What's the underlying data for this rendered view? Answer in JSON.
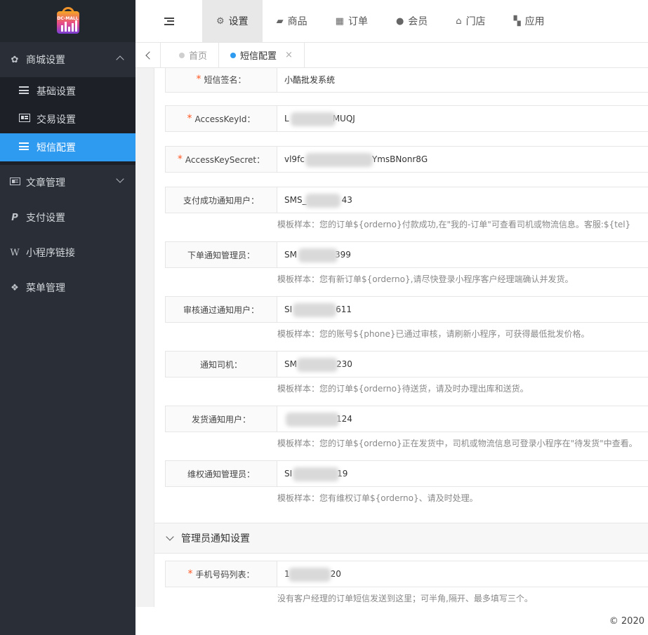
{
  "logo": {
    "text": "DC-MALL"
  },
  "sidebar": {
    "items": [
      {
        "label": "商城设置",
        "icon": "gear-icon",
        "expanded": true
      },
      {
        "label": "文章管理",
        "icon": "newspaper-icon",
        "expanded": false
      },
      {
        "label": "支付设置",
        "icon": "paypal-icon"
      },
      {
        "label": "小程序链接",
        "icon": "weixin-icon"
      },
      {
        "label": "菜单管理",
        "icon": "cubes-icon"
      }
    ],
    "sub_items": [
      {
        "label": "基础设置",
        "icon": "list-icon"
      },
      {
        "label": "交易设置",
        "icon": "id-card-icon"
      },
      {
        "label": "短信配置",
        "icon": "list-icon",
        "active": true
      }
    ]
  },
  "topnav": {
    "tabs": [
      {
        "label": "设置",
        "icon": "gears-icon",
        "active": true
      },
      {
        "label": "商品",
        "icon": "shopping-bag-icon"
      },
      {
        "label": "订单",
        "icon": "table-icon"
      },
      {
        "label": "会员",
        "icon": "user-icon"
      },
      {
        "label": "门店",
        "icon": "bank-icon"
      },
      {
        "label": "应用",
        "icon": "th-large-icon"
      }
    ]
  },
  "page_tabs": [
    {
      "label": "首页"
    },
    {
      "label": "短信配置",
      "active": true,
      "close": "×"
    }
  ],
  "form": {
    "fields": [
      {
        "label": "短信签名：",
        "required": true,
        "value": "小酷批发系统"
      },
      {
        "label": "AccessKeyId：",
        "required": true,
        "value_start": "L",
        "value_end": "MUQJ"
      },
      {
        "label": "AccessKeySecret：",
        "required": true,
        "value_start": "vl9fc",
        "value_end": "YmsBNonr8G"
      },
      {
        "label": "支付成功通知用户：",
        "value_start": "SMS_",
        "value_end": "43",
        "hint": "模板样本：您的订单${orderno}付款成功,在\"我的-订单\"可查看司机或物流信息。客服:${tel}"
      },
      {
        "label": "下单通知管理员：",
        "value_start": "SM",
        "value_end": "399",
        "hint": "模板样本：您有新订单${orderno},请尽快登录小程序客户经理端确认并发货。"
      },
      {
        "label": "审核通过通知用户：",
        "value_start": "SI",
        "value_end": "611",
        "hint": "模板样本：您的账号${phone}已通过审核，请刷新小程序，可获得最低批发价格。"
      },
      {
        "label": "通知司机：",
        "value_start": "SM",
        "value_end": "230",
        "hint": "模板样本：您的订单${orderno}待送货，请及时办理出库和送货。"
      },
      {
        "label": "发货通知用户：",
        "value_start": "",
        "value_end": "124",
        "hint": "模板样本：您的订单${orderno}正在发货中，司机或物流信息可登录小程序在\"待发货\"中查看。"
      },
      {
        "label": "维权通知管理员：",
        "value_start": "SI",
        "value_end": "19",
        "hint": "模板样本：您有维权订单${orderno}、请及时处理。"
      }
    ],
    "section_title": "管理员通知设置",
    "admin_field": {
      "label": "手机号码列表：",
      "required": true,
      "value_start": "1",
      "value_end": "20",
      "hint": "没有客户经理的订单短信发送到这里；可半角,隔开、最多填写三个。"
    }
  },
  "footer": {
    "text": "© 2020"
  },
  "colors": {
    "sidebar_bg": "#2a2f37",
    "active_blue": "#2f9bf0",
    "required": "#ff5722"
  }
}
